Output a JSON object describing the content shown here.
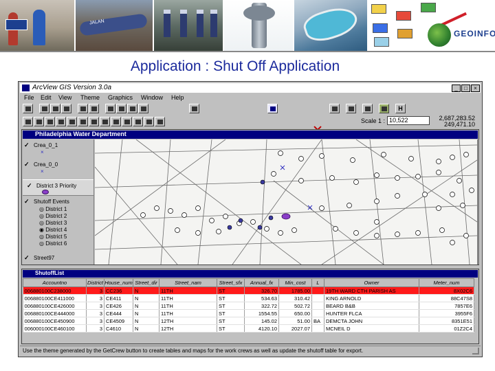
{
  "banner": {
    "pipe_sign_text": "JALAN",
    "logo_text": "GEOINFO"
  },
  "page_title": "Application : Shut Off Application",
  "window": {
    "title": "ArcView GIS Version 3.0a",
    "minimize_label": "_",
    "maximize_label": "□",
    "close_label": "×"
  },
  "menu": [
    "File",
    "Edit",
    "View",
    "Theme",
    "Graphics",
    "Window",
    "Help"
  ],
  "toolbar": {
    "scale_label": "Scale 1 :",
    "scale_value": "10,522",
    "coord_x": "2,687,283.52",
    "coord_y": "249,471.10",
    "h_button_label": "H"
  },
  "view": {
    "title": "Philadelphia Water Department",
    "themes": [
      {
        "label": "Crea_0_1",
        "checked": true,
        "symbol": "×"
      },
      {
        "label": "Crea_0_0",
        "checked": true,
        "symbol": "×"
      },
      {
        "label": "District 3 Priority",
        "checked": true,
        "highlighted": true
      },
      {
        "label": "Shutoff Events",
        "checked": true
      }
    ],
    "districts": [
      "District 1",
      "District 2",
      "District 3",
      "District 4",
      "District 5",
      "District 6"
    ],
    "last_theme": "Street97"
  },
  "table": {
    "title": "ShutoffList",
    "columns": [
      "Accountno",
      "District",
      "House_num",
      "Street_dir",
      "Street_nam",
      "Street_sfx",
      "Annual_fx",
      "Min_cost",
      "L",
      "Owner",
      "Meter_num"
    ],
    "rows": [
      {
        "cells": [
          "006880100C238000",
          "3",
          "CC236",
          "N",
          "11TH",
          "ST",
          "326.70",
          "1785.00",
          "",
          "19TH WARD CTH PARISH AS",
          "8X02C6"
        ],
        "selected": true
      },
      {
        "cells": [
          "006880100CE411000",
          "3",
          "CE411",
          "N",
          "11TH",
          "ST",
          "534.63",
          "310.42",
          "",
          "KING    ARNOLD",
          "88C47S8"
        ],
        "selected": false
      },
      {
        "cells": [
          "006880100CE426000",
          "3",
          "CE426",
          "N",
          "11TH",
          "ST",
          "322.72",
          "502.72",
          "",
          "BEARD   B&B",
          "7857E6"
        ],
        "selected": false
      },
      {
        "cells": [
          "006880100CE444000",
          "3",
          "CE444",
          "N",
          "11TH",
          "ST",
          "1554.55",
          "650.00",
          "",
          "HUNTER  FLCA",
          "3955F6"
        ],
        "selected": false
      },
      {
        "cells": [
          "006880100CE450900",
          "3",
          "CE4509",
          "N",
          "12TH",
          "ST",
          "145.02",
          "51.00",
          "BA",
          "DEMCTA  JOHN",
          "8351E51"
        ],
        "selected": false
      },
      {
        "cells": [
          "006000100CE460100",
          "3",
          "C4610",
          "N",
          "12TH",
          "ST",
          "4120.10",
          "2027.07",
          "",
          "MCNEIL  D",
          "01Z2C4"
        ],
        "selected": false
      }
    ]
  },
  "status": "Use the theme generated by the GetCrew button to create tables and maps for the work crews as well as update the shutoff table for export."
}
